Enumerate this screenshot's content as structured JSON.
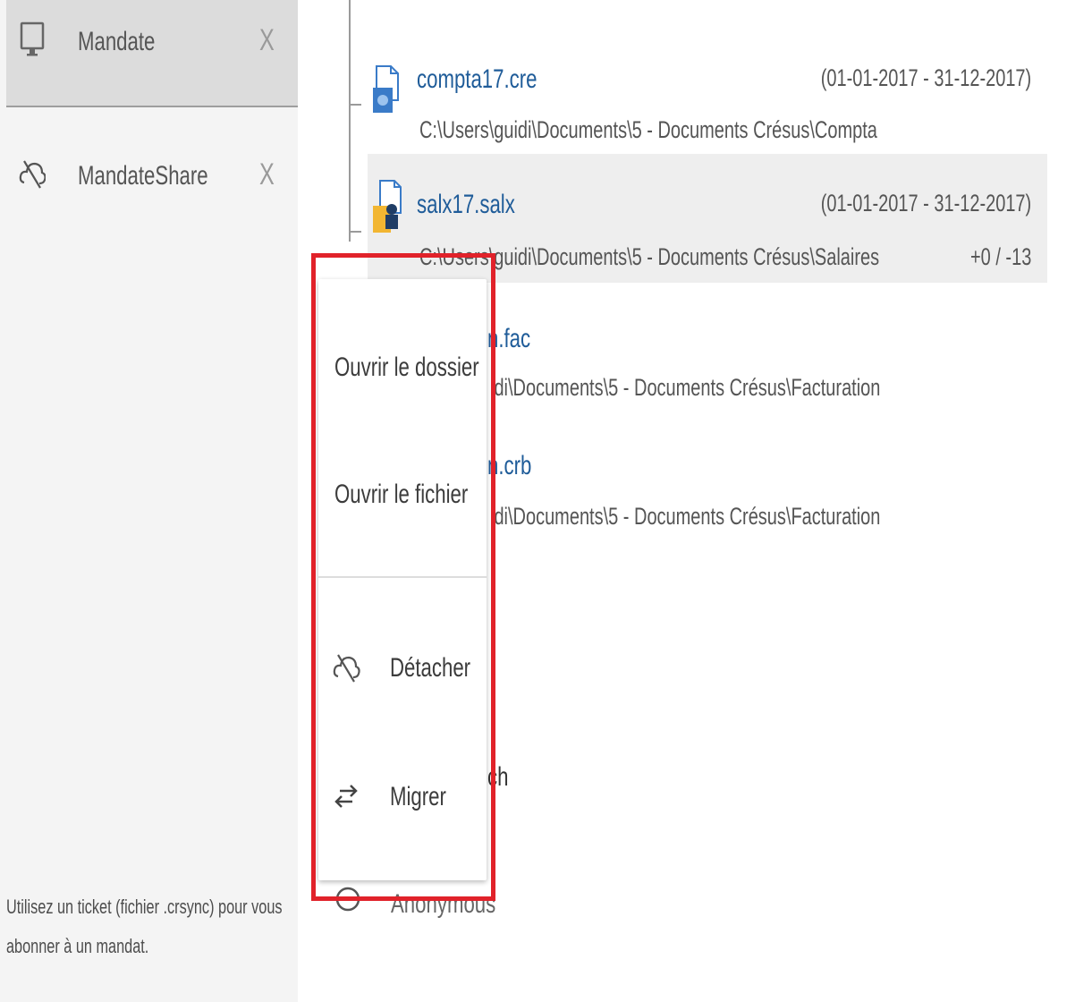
{
  "sidebar": {
    "items": [
      {
        "label": "Mandate",
        "close": "X",
        "icon": "monitor-icon"
      },
      {
        "label": "MandateShare",
        "close": "X",
        "icon": "cloud-off-icon"
      }
    ],
    "footer": {
      "line1": "Utilisez un ticket (fichier .crsync) pour vous",
      "line2": "abonner à un mandat."
    }
  },
  "files": [
    {
      "name": "compta17.cre",
      "path": "C:\\Users\\guidi\\Documents\\5 - Documents Crésus\\Compta",
      "dates": "(01-01-2017 - 31-12-2017)",
      "icon": "compta-file-icon"
    },
    {
      "name": "salx17.salx",
      "path": "C:\\Users\\guidi\\Documents\\5 - Documents Crésus\\Salaires",
      "dates": "(01-01-2017 - 31-12-2017)",
      "count": "+0 / -13",
      "icon": "salaires-file-icon"
    },
    {
      "name_visible": "n.fac",
      "path_visible": "idi\\Documents\\5 - Documents Crésus\\Facturation"
    },
    {
      "name_visible": "n.crb",
      "path_visible": "idi\\Documents\\5 - Documents Crésus\\Facturation"
    }
  ],
  "partials": {
    "ch": "ch",
    "anonymous": "Anonymous"
  },
  "context_menu": {
    "items": [
      {
        "label": "Ouvrir le dossier"
      },
      {
        "label": "Ouvrir le fichier"
      },
      {
        "label": "Détacher",
        "icon": "cloud-off-icon"
      },
      {
        "label": "Migrer",
        "icon": "swap-arrows-icon"
      }
    ]
  },
  "colors": {
    "highlight": "#e1222a",
    "link": "#1f5c99",
    "sidebar_bg": "#f4f4f4",
    "selected_bg": "#eeeeee"
  }
}
